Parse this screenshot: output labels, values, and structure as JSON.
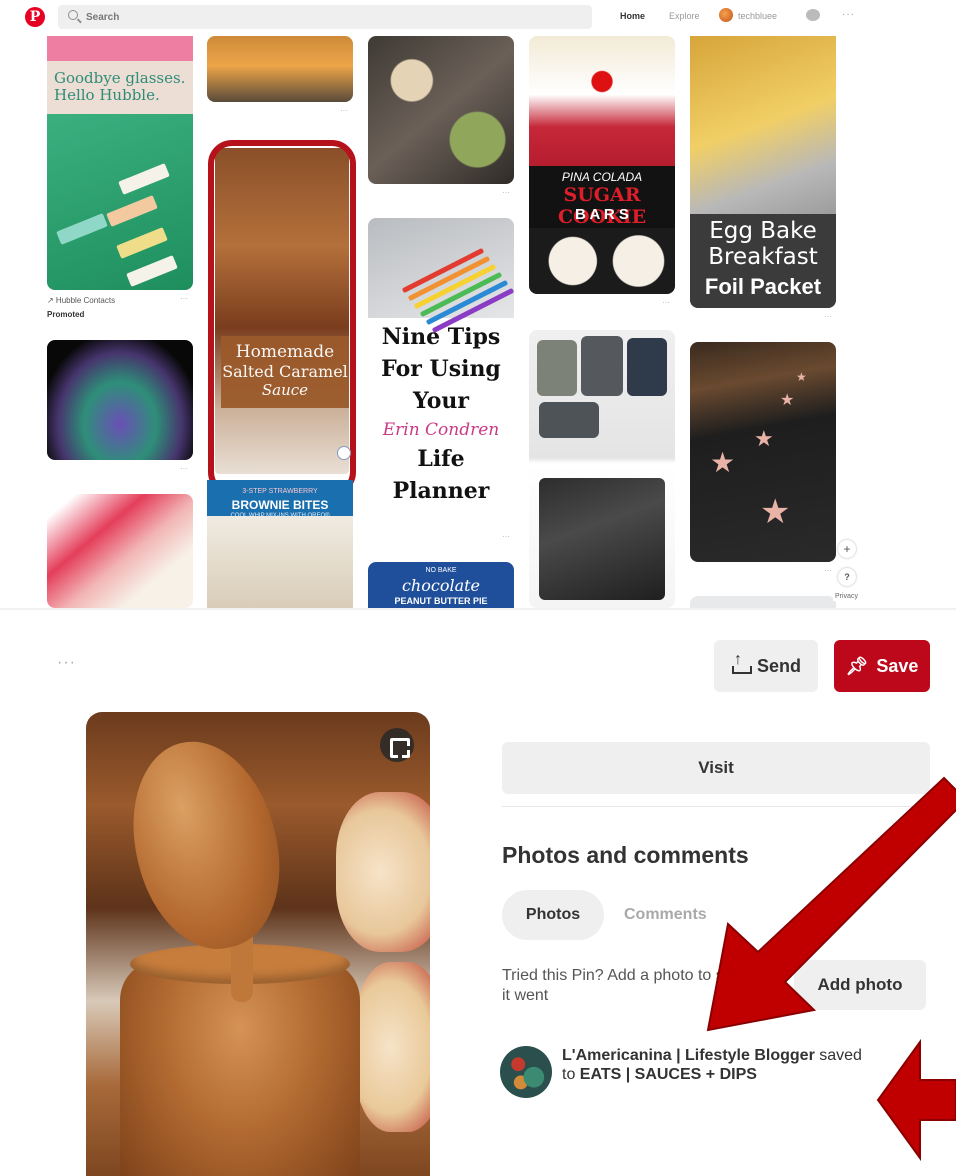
{
  "feed": {
    "logo": "P",
    "search_placeholder": "Search",
    "nav": {
      "home": "Home",
      "explore": "Explore",
      "user": "techbluee",
      "more": "···"
    },
    "pins": {
      "hubble": {
        "headline_line1": "Goodbye glasses.",
        "headline_line2": "Hello Hubble.",
        "source": "↗ Hubble Contacts",
        "promoted": "Promoted",
        "more": "···"
      },
      "caramel": {
        "line1": "Homemade",
        "line2": "Salted Caramel",
        "line3": "Sauce"
      },
      "brownie": {
        "line1": "3-STEP STRAWBERRY",
        "line2": "BROWNIE BITES",
        "line3": "COOL WHIP MIX-INS WITH OREO®"
      },
      "ninetips": {
        "line1": "Nine Tips",
        "line2": "For Using",
        "line3": "Your",
        "line4": "Erin Condren",
        "line5": "Life",
        "line6": "Planner"
      },
      "pbpie": {
        "line1": "NO BAKE",
        "line2": "chocolate",
        "line3": "PEANUT BUTTER PIE"
      },
      "pina": {
        "line1": "PINA COLADA",
        "line2": "SUGAR COOKIE",
        "line3": "B A R S"
      },
      "egg": {
        "line1": "Egg Bake",
        "line2": "Breakfast",
        "line3": "Foil Packet"
      }
    },
    "side_controls": {
      "zoom": "+",
      "help": "?",
      "privacy": "Privacy"
    }
  },
  "closeup": {
    "more": "···",
    "send_label": "Send",
    "save_label": "Save",
    "visit_label": "Visit",
    "section_title": "Photos and comments",
    "tabs": {
      "photos": "Photos",
      "comments": "Comments"
    },
    "tried_text": "Tried this Pin? Add a photo to show how it went",
    "add_photo_label": "Add photo",
    "saver": {
      "name": "L'Americanina | Lifestyle Blogger",
      "action": "saved",
      "to": "to",
      "board": "EATS | SAUCES + DIPS"
    }
  },
  "colors": {
    "brand_red": "#bd081c",
    "highlight_red": "#b5121b",
    "arrow_red": "#c00000"
  },
  "icons": [
    "pinterest-logo-icon",
    "search-icon",
    "chat-icon",
    "more-icon",
    "send-icon",
    "pin-icon",
    "expand-icon",
    "plus-icon",
    "help-icon"
  ]
}
